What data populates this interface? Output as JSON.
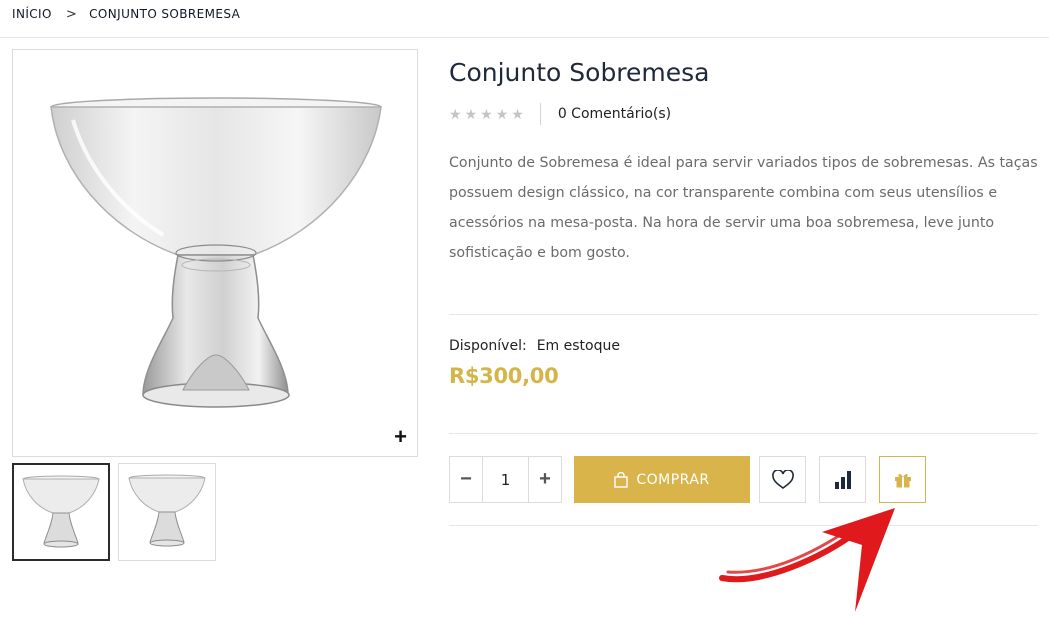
{
  "breadcrumb": {
    "home": "INÍCIO",
    "separator": ">",
    "current": "CONJUNTO SOBREMESA"
  },
  "product": {
    "title": "Conjunto Sobremesa",
    "rating_stars": 0,
    "comments": "0 Comentário(s)",
    "description": "Conjunto de Sobremesa é ideal para servir variados tipos de sobremesas. As taças possuem design clássico, na cor transparente combina com seus utensílios e acessórios na mesa-posta. Na hora de servir uma boa sobremesa, leve junto sofisticação e bom gosto.",
    "availability_label": "Disponível:",
    "availability_value": "Em estoque",
    "price": "R$300,00"
  },
  "gallery": {
    "zoom_symbol": "+",
    "thumbnails": 2,
    "active_index": 0
  },
  "purchase": {
    "quantity": "1",
    "minus": "−",
    "plus": "+",
    "buy_label": "COMPRAR"
  },
  "icons": {
    "wishlist": "heart-icon",
    "compare": "bar-chart-icon",
    "gift": "gift-icon",
    "cart": "shopping-bag-icon"
  },
  "colors": {
    "accent": "#d8b44b",
    "title": "#1e293b",
    "annotation_arrow": "#e0191c"
  }
}
